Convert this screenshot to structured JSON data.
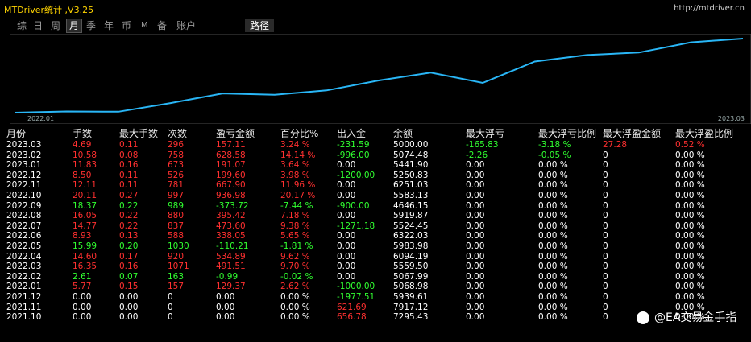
{
  "app": {
    "title": "MTDriver统计 ,V3.25",
    "url": "http://mtdriver.cn"
  },
  "tabs": [
    "综",
    "日",
    "周",
    "月",
    "季",
    "年",
    "币",
    "M",
    "备",
    "账户"
  ],
  "active_tab": "月",
  "route_tab": "路径",
  "chart": {
    "x_start_label": "2022.01",
    "x_end_label": "2023.03",
    "line_color": "#29b6f6",
    "values": [
      0,
      40,
      30,
      310,
      620,
      580,
      720,
      1040,
      1290,
      960,
      1650,
      1860,
      1940,
      2270,
      2390
    ]
  },
  "colors": {
    "red": "#ff3030",
    "green": "#30ff30",
    "white": "#ffffff"
  },
  "table": {
    "headers": [
      "月份",
      "手数",
      "最大手数",
      "次数",
      "盈亏金额",
      "百分比%",
      "出入金",
      "余额",
      "最大浮亏",
      "最大浮亏比例",
      "最大浮盈金额",
      "最大浮盈比例"
    ],
    "rows": [
      [
        "2023.03",
        "4.69",
        "0.11",
        "296",
        "157.11",
        "3.24 %",
        "-231.59",
        "5000.00",
        "-165.83",
        "-3.18 %",
        "27.28",
        "0.52 %"
      ],
      [
        "2023.02",
        "10.58",
        "0.08",
        "758",
        "628.58",
        "14.14 %",
        "-996.00",
        "5074.48",
        "-2.26",
        "-0.05 %",
        "0",
        "0.00 %"
      ],
      [
        "2023.01",
        "11.83",
        "0.16",
        "673",
        "191.07",
        "3.64 %",
        "0.00",
        "5441.90",
        "0.00",
        "0.00 %",
        "0",
        "0.00 %"
      ],
      [
        "2022.12",
        "8.50",
        "0.11",
        "526",
        "199.60",
        "3.98 %",
        "-1200.00",
        "5250.83",
        "0.00",
        "0.00 %",
        "0",
        "0.00 %"
      ],
      [
        "2022.11",
        "12.11",
        "0.11",
        "781",
        "667.90",
        "11.96 %",
        "0.00",
        "6251.03",
        "0.00",
        "0.00 %",
        "0",
        "0.00 %"
      ],
      [
        "2022.10",
        "20.11",
        "0.27",
        "997",
        "936.98",
        "20.17 %",
        "0.00",
        "5583.13",
        "0.00",
        "0.00 %",
        "0",
        "0.00 %"
      ],
      [
        "2022.09",
        "18.37",
        "0.22",
        "989",
        "-373.72",
        "-7.44 %",
        "-900.00",
        "4646.15",
        "0.00",
        "0.00 %",
        "0",
        "0.00 %"
      ],
      [
        "2022.08",
        "16.05",
        "0.22",
        "880",
        "395.42",
        "7.18 %",
        "0.00",
        "5919.87",
        "0.00",
        "0.00 %",
        "0",
        "0.00 %"
      ],
      [
        "2022.07",
        "14.77",
        "0.22",
        "837",
        "473.60",
        "9.38 %",
        "-1271.18",
        "5524.45",
        "0.00",
        "0.00 %",
        "0",
        "0.00 %"
      ],
      [
        "2022.06",
        "8.93",
        "0.13",
        "588",
        "338.05",
        "5.65 %",
        "0.00",
        "6322.03",
        "0.00",
        "0.00 %",
        "0",
        "0.00 %"
      ],
      [
        "2022.05",
        "15.99",
        "0.20",
        "1030",
        "-110.21",
        "-1.81 %",
        "0.00",
        "5983.98",
        "0.00",
        "0.00 %",
        "0",
        "0.00 %"
      ],
      [
        "2022.04",
        "14.60",
        "0.17",
        "920",
        "534.89",
        "9.62 %",
        "0.00",
        "6094.19",
        "0.00",
        "0.00 %",
        "0",
        "0.00 %"
      ],
      [
        "2022.03",
        "16.35",
        "0.16",
        "1071",
        "491.51",
        "9.70 %",
        "0.00",
        "5559.50",
        "0.00",
        "0.00 %",
        "0",
        "0.00 %"
      ],
      [
        "2022.02",
        "2.61",
        "0.07",
        "163",
        "-0.99",
        "-0.02 %",
        "0.00",
        "5067.99",
        "0.00",
        "0.00 %",
        "0",
        "0.00 %"
      ],
      [
        "2022.01",
        "5.77",
        "0.15",
        "157",
        "129.37",
        "2.62 %",
        "-1000.00",
        "5068.98",
        "0.00",
        "0.00 %",
        "0",
        "0.00 %"
      ],
      [
        "2021.12",
        "0.00",
        "0.00",
        "0",
        "0.00",
        "0.00 %",
        "-1977.51",
        "5939.61",
        "0.00",
        "0.00 %",
        "0",
        "0.00 %"
      ],
      [
        "2021.11",
        "0.00",
        "0.00",
        "0",
        "0.00",
        "0.00 %",
        "621.69",
        "7917.12",
        "0.00",
        "0.00 %",
        "0",
        "0.00 %"
      ],
      [
        "2021.10",
        "0.00",
        "0.00",
        "0",
        "0.00",
        "0.00 %",
        "656.78",
        "7295.43",
        "0.00",
        "0.00 %",
        "0",
        "0.00 %"
      ]
    ],
    "row_colors": [
      "red",
      "red",
      "red",
      "red",
      "red",
      "red",
      "green",
      "red",
      "red",
      "red",
      "green",
      "red",
      "red",
      "green",
      "red",
      "white",
      "white",
      "white"
    ]
  },
  "watermark": "@EA交易金手指"
}
